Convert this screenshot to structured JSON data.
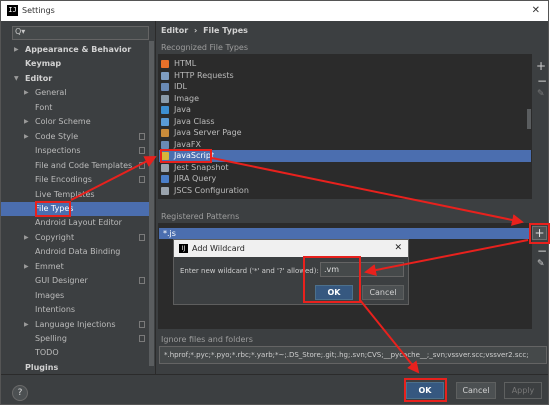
{
  "window": {
    "title": "Settings",
    "app_icon_text": "IJ"
  },
  "search": {
    "placeholder": "Q▾"
  },
  "sidebar": {
    "items": [
      {
        "label": "Appearance & Behavior",
        "arrow": "▶",
        "bold": true
      },
      {
        "label": "Keymap",
        "bold": true
      },
      {
        "label": "Editor",
        "arrow": "▼",
        "bold": true
      },
      {
        "label": "General",
        "arrow": "▶"
      },
      {
        "label": "Font"
      },
      {
        "label": "Color Scheme",
        "arrow": "▶"
      },
      {
        "label": "Code Style",
        "arrow": "▶",
        "cfg": true
      },
      {
        "label": "Inspections",
        "cfg": true
      },
      {
        "label": "File and Code Templates",
        "cfg": true
      },
      {
        "label": "File Encodings",
        "cfg": true
      },
      {
        "label": "Live Templates"
      },
      {
        "label": "File Types",
        "selected": true
      },
      {
        "label": "Android Layout Editor"
      },
      {
        "label": "Copyright",
        "arrow": "▶",
        "cfg": true
      },
      {
        "label": "Android Data Binding"
      },
      {
        "label": "Emmet",
        "arrow": "▶"
      },
      {
        "label": "GUI Designer",
        "cfg": true
      },
      {
        "label": "Images"
      },
      {
        "label": "Intentions"
      },
      {
        "label": "Language Injections",
        "arrow": "▶",
        "cfg": true
      },
      {
        "label": "Spelling",
        "cfg": true
      },
      {
        "label": "TODO"
      },
      {
        "label": "Plugins",
        "bold": true
      }
    ]
  },
  "breadcrumb": {
    "parent": "Editor",
    "sep": "›",
    "current": "File Types"
  },
  "recognized": {
    "title": "Recognized File Types",
    "items": [
      {
        "label": "HTML",
        "color": "#e8702a"
      },
      {
        "label": "HTTP Requests",
        "color": "#7f9ec2"
      },
      {
        "label": "IDL",
        "color": "#6a8ab5"
      },
      {
        "label": "Image",
        "color": "#8a9aa8"
      },
      {
        "label": "Java",
        "color": "#3d8fd1"
      },
      {
        "label": "Java Class",
        "color": "#5a9bd5"
      },
      {
        "label": "Java Server Page",
        "color": "#c98b3a"
      },
      {
        "label": "JavaFX",
        "color": "#6a8ab5"
      },
      {
        "label": "JavaScript",
        "color": "#d6b43a",
        "selected": true
      },
      {
        "label": "Jest Snapshot",
        "color": "#9aa3ad"
      },
      {
        "label": "JIRA Query",
        "color": "#4a7ec9"
      },
      {
        "label": "JSCS Configuration",
        "color": "#9aa3ad"
      }
    ]
  },
  "patterns": {
    "title": "Registered Patterns",
    "items": [
      "*.js"
    ]
  },
  "tool_buttons": {
    "add": "+",
    "remove": "−",
    "edit": "✎"
  },
  "dialog": {
    "title": "Add Wildcard",
    "label": "Enter new wildcard ('*' and '?' allowed):",
    "value": ".vm",
    "ok": "OK",
    "cancel": "Cancel",
    "close": "✕"
  },
  "ignore": {
    "title": "Ignore files and folders",
    "value": "*.hprof;*.pyc;*.pyo;*.rbc;*.yarb;*~;.DS_Store;.git;.hg;.svn;CVS;__pycache__;_svn;vssver.scc;vssver2.scc;"
  },
  "footer": {
    "help": "?",
    "ok": "OK",
    "cancel": "Cancel",
    "apply": "Apply"
  },
  "colors": {
    "accent": "#4b6eaf",
    "annotation": "#e8211d",
    "background": "#3c3f41"
  }
}
